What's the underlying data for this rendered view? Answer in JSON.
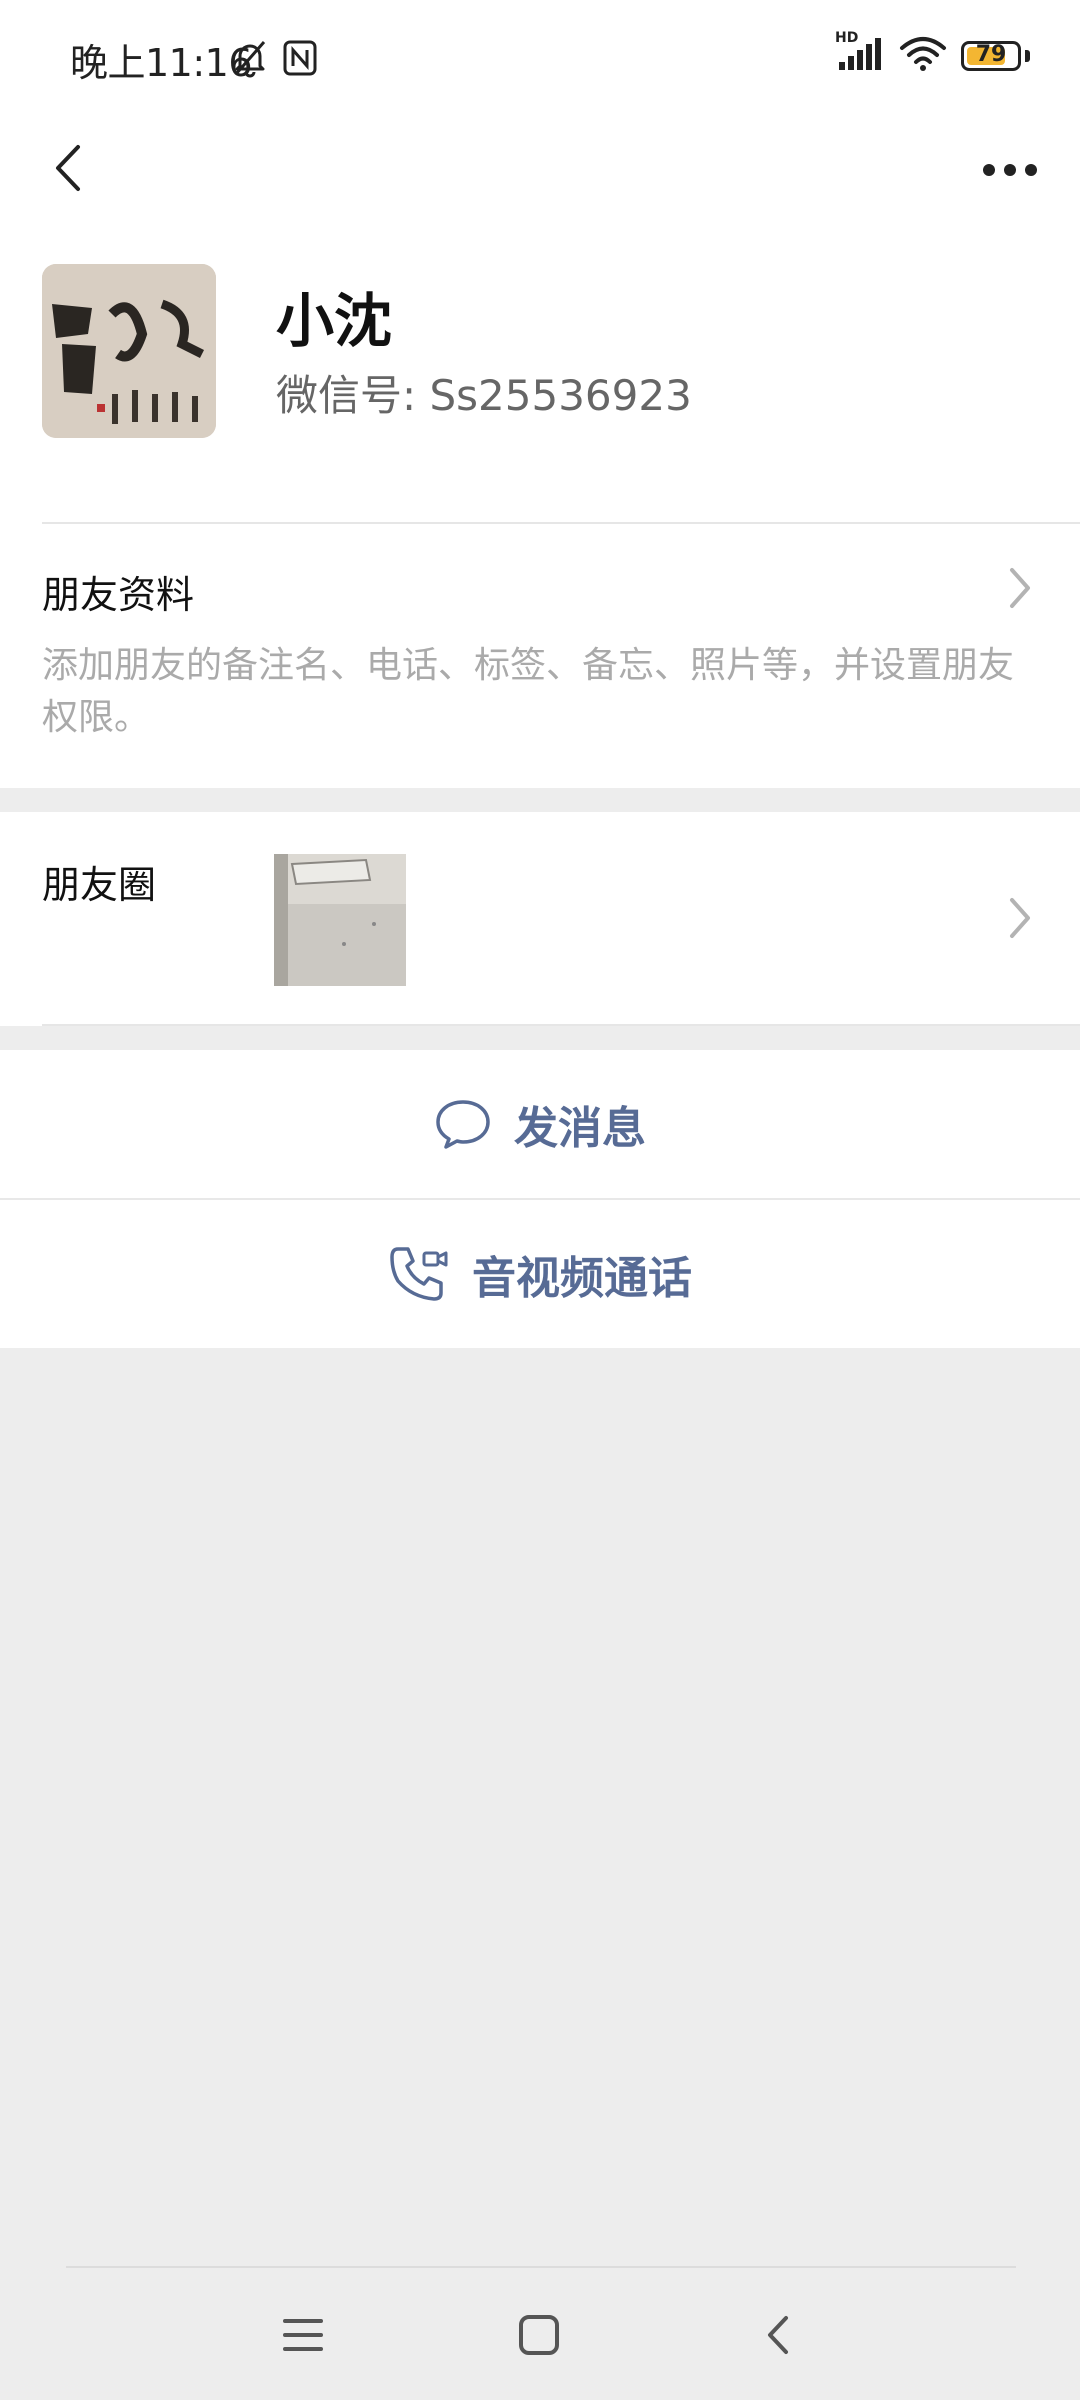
{
  "status_bar": {
    "time": "晚上11:16",
    "battery": "79",
    "network_label": "HD"
  },
  "profile": {
    "name": "小沈",
    "wechat_id": "微信号: Ss25536923"
  },
  "friend_info": {
    "title": "朋友资料",
    "description": "添加朋友的备注名、电话、标签、备忘、照片等，并设置朋友权限。"
  },
  "moments": {
    "title": "朋友圈"
  },
  "actions": {
    "send_message": "发消息",
    "voice_video_call": "音视频通话"
  },
  "colors": {
    "accent": "#576b95",
    "background": "#ededed",
    "battery": "#f3b632"
  }
}
